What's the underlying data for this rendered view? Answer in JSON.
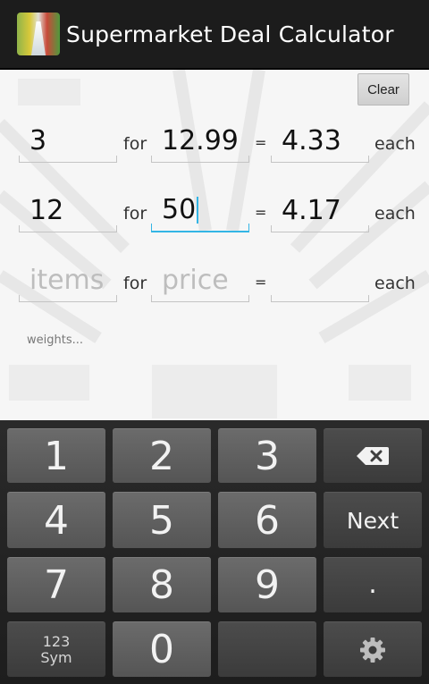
{
  "app": {
    "title": "Supermarket Deal Calculator",
    "icon": "supermarket-aisle-icon",
    "accent": "#33b5e5"
  },
  "clear_label": "Clear",
  "rows": [
    {
      "items": "3",
      "for": "for",
      "price": "12.99",
      "equals": "=",
      "result": "4.33",
      "each": "each"
    },
    {
      "items": "12",
      "for": "for",
      "price": "50",
      "equals": "=",
      "result": "4.17",
      "each": "each"
    },
    {
      "items_placeholder": "items",
      "for": "for",
      "price_placeholder": "price",
      "equals": "=",
      "result": "",
      "each": "each"
    }
  ],
  "weights_label": "weights...",
  "keyboard": {
    "keys": {
      "k1": "1",
      "k2": "2",
      "k3": "3",
      "k4": "4",
      "k5": "5",
      "k6": "6",
      "k7": "7",
      "k8": "8",
      "k9": "9",
      "k0": "0",
      "next": "Next",
      "dot": ".",
      "sym_top": "123",
      "sym_bottom": "Sym"
    },
    "icons": {
      "backspace": "backspace-icon",
      "settings": "gear-icon"
    }
  }
}
